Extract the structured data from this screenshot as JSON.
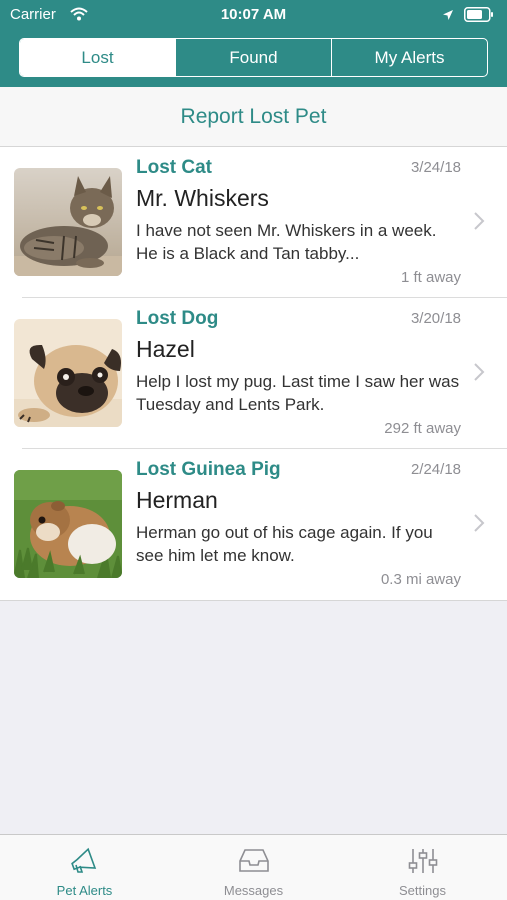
{
  "status_bar": {
    "carrier": "Carrier",
    "time": "10:07 AM"
  },
  "segments": [
    {
      "label": "Lost",
      "active": true
    },
    {
      "label": "Found",
      "active": false
    },
    {
      "label": "My Alerts",
      "active": false
    }
  ],
  "report_label": "Report Lost Pet",
  "alerts": [
    {
      "type": "Lost Cat",
      "date": "3/24/18",
      "name": "Mr. Whiskers",
      "description": "I have not seen Mr. Whiskers in a week.  He is a Black and Tan tabby...",
      "distance": "1 ft away",
      "photo": "tabby-cat-photo"
    },
    {
      "type": "Lost Dog",
      "date": "3/20/18",
      "name": "Hazel",
      "description": "Help I lost my pug.  Last time I saw her was Tuesday and Lents Park.",
      "distance": "292 ft away",
      "photo": "pug-photo"
    },
    {
      "type": "Lost Guinea Pig",
      "date": "2/24/18",
      "name": "Herman",
      "description": "Herman go out of his cage again.  If you see him let me know.",
      "distance": "0.3 mi away",
      "photo": "guinea-pig-photo"
    }
  ],
  "tabs": [
    {
      "label": "Pet Alerts",
      "icon": "megaphone-icon",
      "active": true
    },
    {
      "label": "Messages",
      "icon": "inbox-tray-icon",
      "active": false
    },
    {
      "label": "Settings",
      "icon": "sliders-icon",
      "active": false
    }
  ],
  "colors": {
    "accent": "#2e8b87",
    "background": "#efeff4",
    "secondary_text": "#8e8e93"
  }
}
